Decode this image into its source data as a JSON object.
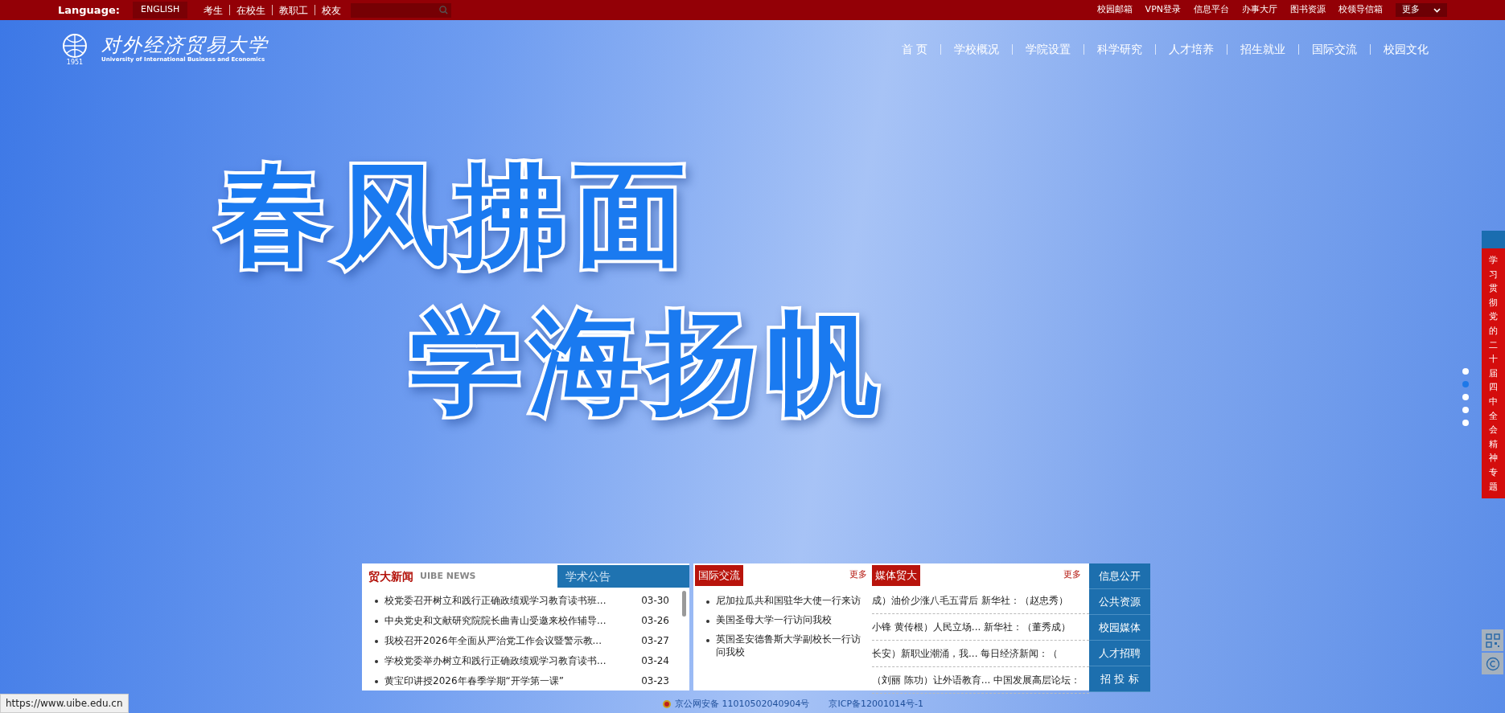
{
  "top_bar": {
    "language_label": "Language:",
    "language_button": "ENGLISH",
    "audience_links": [
      "考生",
      "在校生",
      "教职工",
      "校友"
    ],
    "quick_links": [
      "校园邮箱",
      "VPN登录",
      "信息平台",
      "办事大厅",
      "图书资源",
      "校领导信箱"
    ],
    "more_button": "更多"
  },
  "header": {
    "logo_year": "1951",
    "logo_name": "对外经济贸易大学",
    "logo_subtitle": "University of International Business and Economics",
    "nav": [
      "首 页",
      "学校概况",
      "学院设置",
      "科学研究",
      "人才培养",
      "招生就业",
      "国际交流",
      "校园文化"
    ]
  },
  "hero": {
    "slogans": [
      "春风拂面",
      "学海扬帆"
    ],
    "dots": [
      {
        "selected": false
      },
      {
        "selected": true
      },
      {
        "selected": false
      },
      {
        "selected": false
      },
      {
        "selected": false
      }
    ]
  },
  "news_panel": {
    "tabs": [
      {
        "label": "贸大新闻",
        "sub": "UIBE NEWS",
        "selected": true
      },
      {
        "label": "学术公告",
        "selected": false
      }
    ],
    "items": [
      {
        "title": "校党委召开树立和践行正确政绩观学习教育读书班...",
        "date": "03-30"
      },
      {
        "title": "中央党史和文献研究院院长曲青山受邀来校作辅导...",
        "date": "03-26"
      },
      {
        "title": "我校召开2026年全面从严治党工作会议暨警示教...",
        "date": "03-27"
      },
      {
        "title": "学校党委举办树立和践行正确政绩观学习教育读书...",
        "date": "03-24"
      },
      {
        "title": "黄宝印讲授2026年春季学期“开学第一课”",
        "date": "03-23"
      }
    ]
  },
  "intl_panel": {
    "title": "国际交流",
    "more": "更多",
    "items": [
      "尼加拉瓜共和国驻华大使一行来访",
      "美国圣母大学一行访问我校",
      "英国圣安德鲁斯大学副校长一行访问我校"
    ]
  },
  "media_panel": {
    "title": "媒体贸大",
    "more": "更多",
    "items": [
      "成）油价少涨八毛五背后 新华社：（赵忠秀）",
      "小锋 黄传根）人民立场... 新华社：（董秀成）",
      "长安）新职业潮涌，我... 每日经济新闻：（",
      "（刘丽 陈功）让外语教育... 中国发展高层论坛："
    ]
  },
  "side_menu": [
    "信息公开",
    "公共资源",
    "校园媒体",
    "人才招聘",
    "招 投 标"
  ],
  "side_banner": "学习贯彻党的二十届四中全会精神专题",
  "footer": [
    "京公网安备 11010502040904号",
    "京ICP备12001014号-1"
  ],
  "status_url": "https://www.uibe.edu.cn"
}
